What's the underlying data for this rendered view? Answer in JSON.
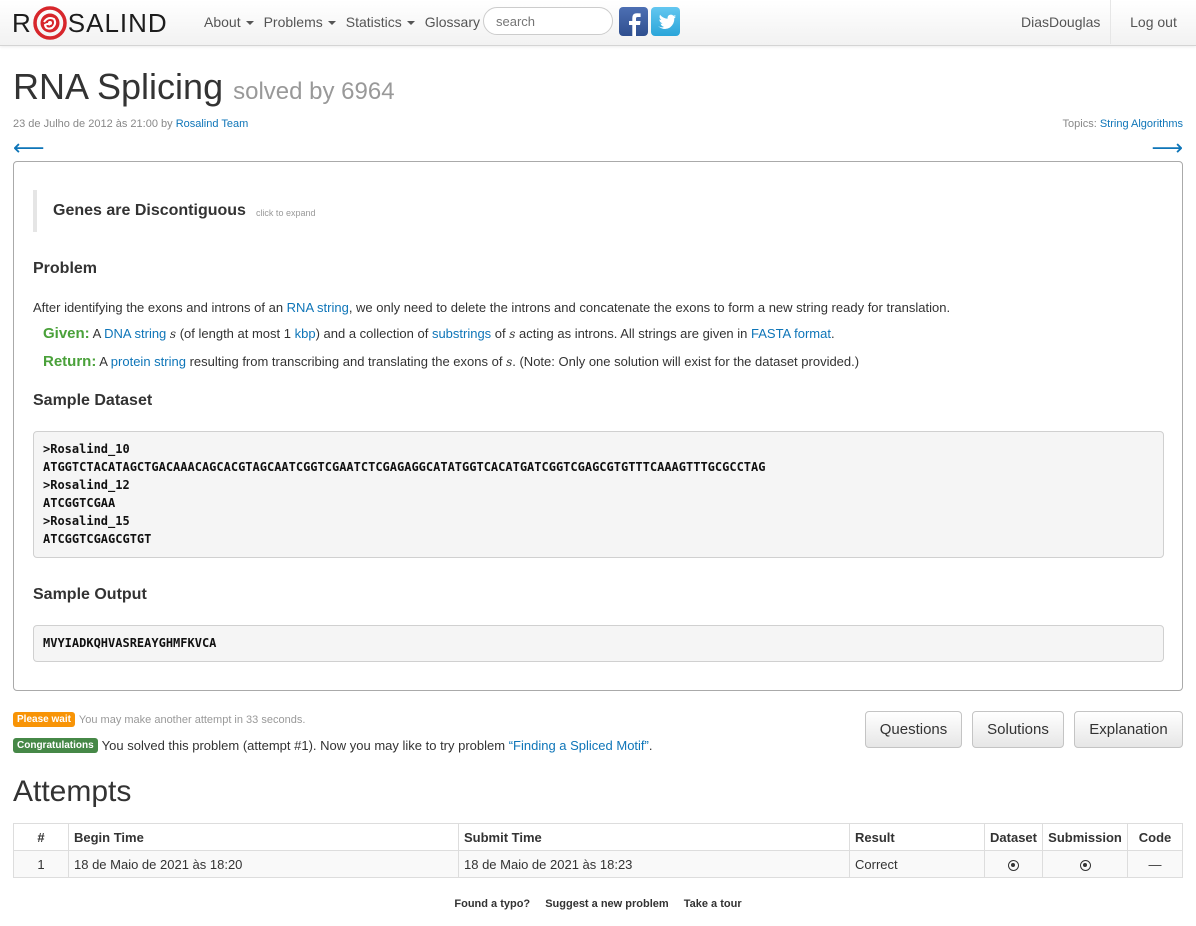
{
  "nav": {
    "logo_left": "R",
    "logo_right": "SALIND",
    "menu": [
      "About",
      "Problems",
      "Statistics",
      "Glossary"
    ],
    "search_placeholder": "search",
    "user": "DiasDouglas",
    "logout": "Log out"
  },
  "header": {
    "title": "RNA Splicing",
    "solved_by": "solved by 6964",
    "date": "23 de Julho de 2012 às 21:00 by ",
    "author": "Rosalind Team",
    "topics_label": "Topics: ",
    "topics": "String Algorithms",
    "prev_arrow": "⟵",
    "next_arrow": "⟶"
  },
  "problem": {
    "blockquote_title": "Genes are Discontiguous",
    "blockquote_hint": "click to expand",
    "problem_heading": "Problem",
    "intro": {
      "t1": "After identifying the exons and introns of an ",
      "link1": "RNA string",
      "t2": ", we only need to delete the introns and concatenate the exons to form a new string ready for translation."
    },
    "given": {
      "label": "Given:",
      "t1": " A ",
      "link1": "DNA string",
      "t2": " ",
      "var": "s",
      "t3": " (of length at most 1 ",
      "link2": "kbp",
      "t4": ") and a collection of ",
      "link3": "substrings",
      "t5": " of ",
      "var2": "s",
      "t6": " acting as introns. All strings are given in ",
      "link4": "FASTA format",
      "t7": "."
    },
    "return": {
      "label": "Return:",
      "t1": " A ",
      "link1": "protein string",
      "t2": " resulting from transcribing and translating the exons of ",
      "var": "s",
      "t3": ". (Note: Only one solution will exist for the dataset provided.)"
    },
    "dataset_heading": "Sample Dataset",
    "dataset": ">Rosalind_10\nATGGTCTACATAGCTGACAAACAGCACGTAGCAATCGGTCGAATCTCGAGAGGCATATGGTCACATGATCGGTCGAGCGTGTTTCAAAGTTTGCGCCTAG\n>Rosalind_12\nATCGGTCGAA\n>Rosalind_15\nATCGGTCGAGCGTGT",
    "output_heading": "Sample Output",
    "output": "MVYIADKQHVASREAYGHMFKVCA"
  },
  "status": {
    "wait_badge": "Please wait",
    "wait_text": "You may make another attempt in 33 seconds.",
    "ok_badge": "Congratulations",
    "ok_text": "You solved this problem (attempt #1). Now you may like to try problem ",
    "ok_link": "“Finding a Spliced Motif”",
    "ok_end": "."
  },
  "buttons": {
    "questions": "Questions",
    "solutions": "Solutions",
    "explanation": "Explanation"
  },
  "attempts": {
    "heading": "Attempts",
    "columns": [
      "#",
      "Begin Time",
      "Submit Time",
      "Result",
      "Dataset",
      "Submission",
      "Code"
    ],
    "row": {
      "num": "1",
      "begin": "18 de Maio de 2021 às 18:20",
      "submit": "18 de Maio de 2021 às 18:23",
      "result": "Correct",
      "code": "—"
    }
  },
  "footer": {
    "typo": "Found a typo?",
    "suggest": "Suggest a new problem",
    "tour": "Take a tour"
  },
  "colors": {
    "link": "#0e75b8",
    "given_label": "#4aa13a",
    "wait_badge": "#f89406",
    "ok_badge": "#468847",
    "logo_red": "#d7262b"
  }
}
